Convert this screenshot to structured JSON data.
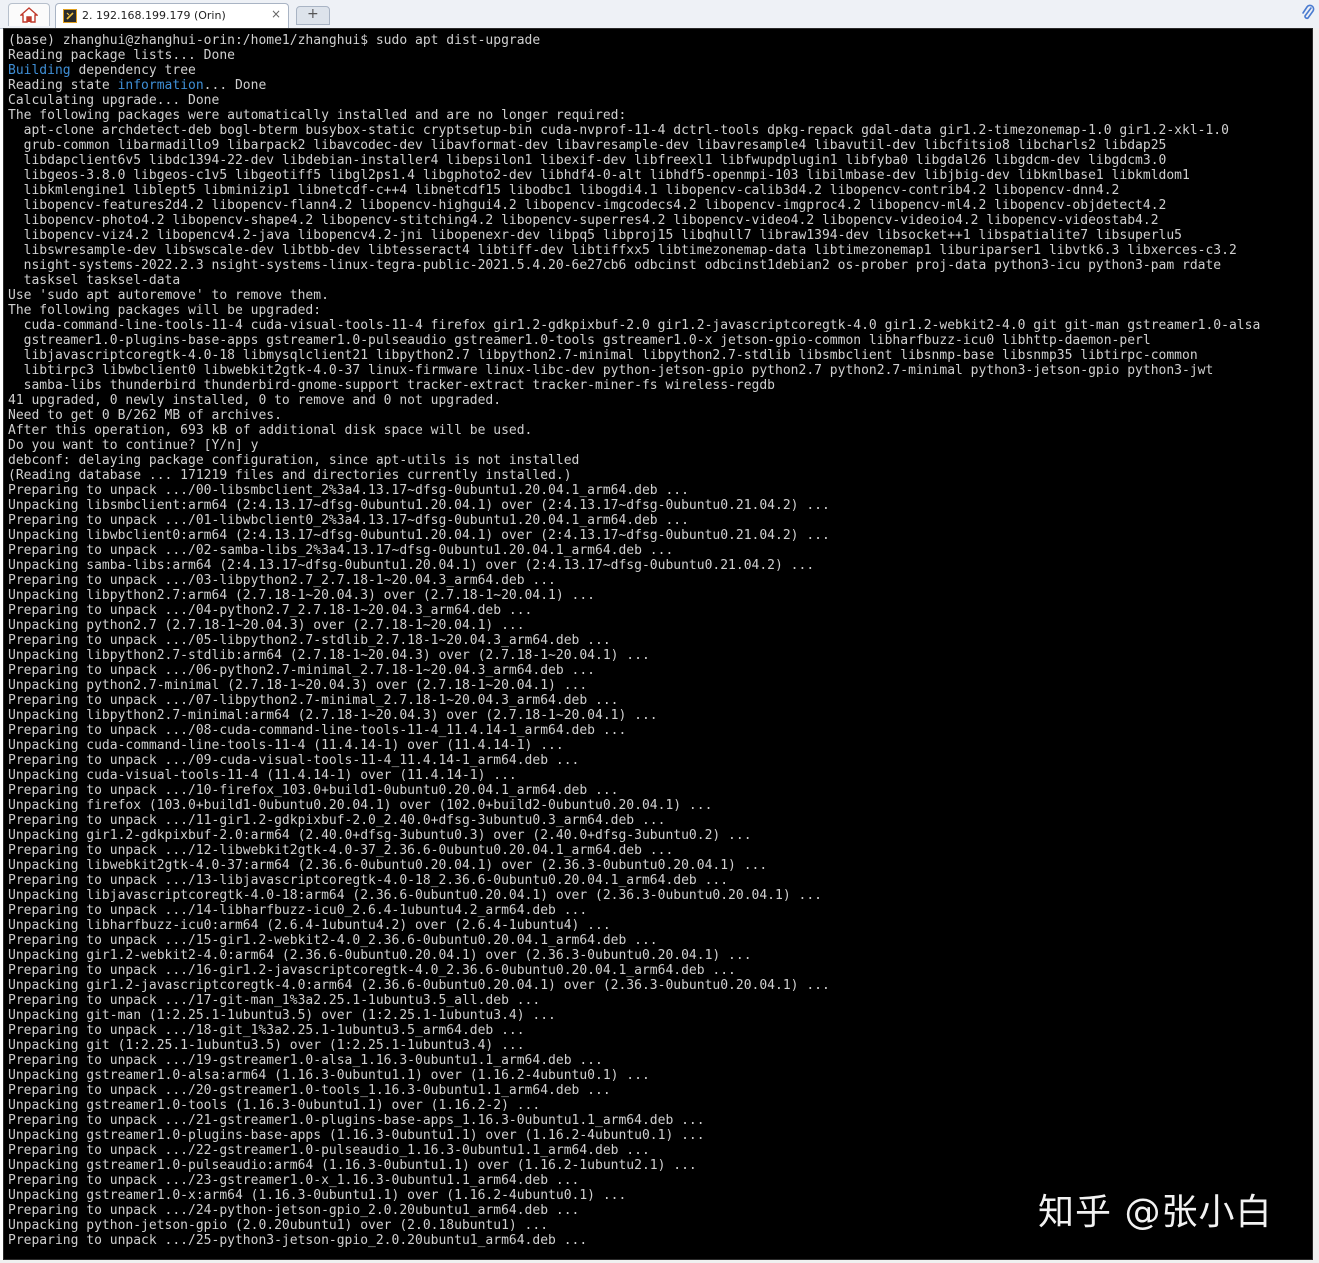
{
  "window": {
    "tab_title": "2. 192.168.199.179 (Orin)",
    "tab_close": "×",
    "newtab_symbol": "+",
    "home_icon": "home-icon",
    "paperclip_icon": "paperclip-icon"
  },
  "terminal": {
    "lines": [
      "(base) zhanghui@zhanghui-orin:/home1/zhanghui$ sudo apt dist-upgrade",
      "Reading package lists... Done",
      "Building dependency tree",
      "Reading state information... Done",
      "Calculating upgrade... Done",
      "The following packages were automatically installed and are no longer required:",
      "  apt-clone archdetect-deb bogl-bterm busybox-static cryptsetup-bin cuda-nvprof-11-4 dctrl-tools dpkg-repack gdal-data gir1.2-timezonemap-1.0 gir1.2-xkl-1.0",
      "  grub-common libarmadillo9 libarpack2 libavcodec-dev libavformat-dev libavresample-dev libavresample4 libavutil-dev libcfitsio8 libcharls2 libdap25",
      "  libdapclient6v5 libdc1394-22-dev libdebian-installer4 libepsilon1 libexif-dev libfreexl1 libfwupdplugin1 libfyba0 libgdal26 libgdcm-dev libgdcm3.0",
      "  libgeos-3.8.0 libgeos-c1v5 libgeotiff5 libgl2ps1.4 libgphoto2-dev libhdf4-0-alt libhdf5-openmpi-103 libilmbase-dev libjbig-dev libkmlbase1 libkmldom1",
      "  libkmlengine1 liblept5 libminizip1 libnetcdf-c++4 libnetcdf15 libodbc1 libogdi4.1 libopencv-calib3d4.2 libopencv-contrib4.2 libopencv-dnn4.2",
      "  libopencv-features2d4.2 libopencv-flann4.2 libopencv-highgui4.2 libopencv-imgcodecs4.2 libopencv-imgproc4.2 libopencv-ml4.2 libopencv-objdetect4.2",
      "  libopencv-photo4.2 libopencv-shape4.2 libopencv-stitching4.2 libopencv-superres4.2 libopencv-video4.2 libopencv-videoio4.2 libopencv-videostab4.2",
      "  libopencv-viz4.2 libopencv4.2-java libopencv4.2-jni libopenexr-dev libpq5 libproj15 libqhull7 libraw1394-dev libsocket++1 libspatialite7 libsuperlu5",
      "  libswresample-dev libswscale-dev libtbb-dev libtesseract4 libtiff-dev libtiffxx5 libtimezonemap-data libtimezonemap1 liburiparser1 libvtk6.3 libxerces-c3.2",
      "  nsight-systems-2022.2.3 nsight-systems-linux-tegra-public-2021.5.4.20-6e27cb6 odbcinst odbcinst1debian2 os-prober proj-data python3-icu python3-pam rdate",
      "  tasksel tasksel-data",
      "Use 'sudo apt autoremove' to remove them.",
      "The following packages will be upgraded:",
      "  cuda-command-line-tools-11-4 cuda-visual-tools-11-4 firefox gir1.2-gdkpixbuf-2.0 gir1.2-javascriptcoregtk-4.0 gir1.2-webkit2-4.0 git git-man gstreamer1.0-alsa",
      "  gstreamer1.0-plugins-base-apps gstreamer1.0-pulseaudio gstreamer1.0-tools gstreamer1.0-x jetson-gpio-common libharfbuzz-icu0 libhttp-daemon-perl",
      "  libjavascriptcoregtk-4.0-18 libmysqlclient21 libpython2.7 libpython2.7-minimal libpython2.7-stdlib libsmbclient libsnmp-base libsnmp35 libtirpc-common",
      "  libtirpc3 libwbclient0 libwebkit2gtk-4.0-37 linux-firmware linux-libc-dev python-jetson-gpio python2.7 python2.7-minimal python3-jetson-gpio python3-jwt",
      "  samba-libs thunderbird thunderbird-gnome-support tracker-extract tracker-miner-fs wireless-regdb",
      "41 upgraded, 0 newly installed, 0 to remove and 0 not upgraded.",
      "Need to get 0 B/262 MB of archives.",
      "After this operation, 693 kB of additional disk space will be used.",
      "Do you want to continue? [Y/n] y",
      "debconf: delaying package configuration, since apt-utils is not installed",
      "(Reading database ... 171219 files and directories currently installed.)",
      "Preparing to unpack .../00-libsmbclient_2%3a4.13.17~dfsg-0ubuntu1.20.04.1_arm64.deb ...",
      "Unpacking libsmbclient:arm64 (2:4.13.17~dfsg-0ubuntu1.20.04.1) over (2:4.13.17~dfsg-0ubuntu0.21.04.2) ...",
      "Preparing to unpack .../01-libwbclient0_2%3a4.13.17~dfsg-0ubuntu1.20.04.1_arm64.deb ...",
      "Unpacking libwbclient0:arm64 (2:4.13.17~dfsg-0ubuntu1.20.04.1) over (2:4.13.17~dfsg-0ubuntu0.21.04.2) ...",
      "Preparing to unpack .../02-samba-libs_2%3a4.13.17~dfsg-0ubuntu1.20.04.1_arm64.deb ...",
      "Unpacking samba-libs:arm64 (2:4.13.17~dfsg-0ubuntu1.20.04.1) over (2:4.13.17~dfsg-0ubuntu0.21.04.2) ...",
      "Preparing to unpack .../03-libpython2.7_2.7.18-1~20.04.3_arm64.deb ...",
      "Unpacking libpython2.7:arm64 (2.7.18-1~20.04.3) over (2.7.18-1~20.04.1) ...",
      "Preparing to unpack .../04-python2.7_2.7.18-1~20.04.3_arm64.deb ...",
      "Unpacking python2.7 (2.7.18-1~20.04.3) over (2.7.18-1~20.04.1) ...",
      "Preparing to unpack .../05-libpython2.7-stdlib_2.7.18-1~20.04.3_arm64.deb ...",
      "Unpacking libpython2.7-stdlib:arm64 (2.7.18-1~20.04.3) over (2.7.18-1~20.04.1) ...",
      "Preparing to unpack .../06-python2.7-minimal_2.7.18-1~20.04.3_arm64.deb ...",
      "Unpacking python2.7-minimal (2.7.18-1~20.04.3) over (2.7.18-1~20.04.1) ...",
      "Preparing to unpack .../07-libpython2.7-minimal_2.7.18-1~20.04.3_arm64.deb ...",
      "Unpacking libpython2.7-minimal:arm64 (2.7.18-1~20.04.3) over (2.7.18-1~20.04.1) ...",
      "Preparing to unpack .../08-cuda-command-line-tools-11-4_11.4.14-1_arm64.deb ...",
      "Unpacking cuda-command-line-tools-11-4 (11.4.14-1) over (11.4.14-1) ...",
      "Preparing to unpack .../09-cuda-visual-tools-11-4_11.4.14-1_arm64.deb ...",
      "Unpacking cuda-visual-tools-11-4 (11.4.14-1) over (11.4.14-1) ...",
      "Preparing to unpack .../10-firefox_103.0+build1-0ubuntu0.20.04.1_arm64.deb ...",
      "Unpacking firefox (103.0+build1-0ubuntu0.20.04.1) over (102.0+build2-0ubuntu0.20.04.1) ...",
      "Preparing to unpack .../11-gir1.2-gdkpixbuf-2.0_2.40.0+dfsg-3ubuntu0.3_arm64.deb ...",
      "Unpacking gir1.2-gdkpixbuf-2.0:arm64 (2.40.0+dfsg-3ubuntu0.3) over (2.40.0+dfsg-3ubuntu0.2) ...",
      "Preparing to unpack .../12-libwebkit2gtk-4.0-37_2.36.6-0ubuntu0.20.04.1_arm64.deb ...",
      "Unpacking libwebkit2gtk-4.0-37:arm64 (2.36.6-0ubuntu0.20.04.1) over (2.36.3-0ubuntu0.20.04.1) ...",
      "Preparing to unpack .../13-libjavascriptcoregtk-4.0-18_2.36.6-0ubuntu0.20.04.1_arm64.deb ...",
      "Unpacking libjavascriptcoregtk-4.0-18:arm64 (2.36.6-0ubuntu0.20.04.1) over (2.36.3-0ubuntu0.20.04.1) ...",
      "Preparing to unpack .../14-libharfbuzz-icu0_2.6.4-1ubuntu4.2_arm64.deb ...",
      "Unpacking libharfbuzz-icu0:arm64 (2.6.4-1ubuntu4.2) over (2.6.4-1ubuntu4) ...",
      "Preparing to unpack .../15-gir1.2-webkit2-4.0_2.36.6-0ubuntu0.20.04.1_arm64.deb ...",
      "Unpacking gir1.2-webkit2-4.0:arm64 (2.36.6-0ubuntu0.20.04.1) over (2.36.3-0ubuntu0.20.04.1) ...",
      "Preparing to unpack .../16-gir1.2-javascriptcoregtk-4.0_2.36.6-0ubuntu0.20.04.1_arm64.deb ...",
      "Unpacking gir1.2-javascriptcoregtk-4.0:arm64 (2.36.6-0ubuntu0.20.04.1) over (2.36.3-0ubuntu0.20.04.1) ...",
      "Preparing to unpack .../17-git-man_1%3a2.25.1-1ubuntu3.5_all.deb ...",
      "Unpacking git-man (1:2.25.1-1ubuntu3.5) over (1:2.25.1-1ubuntu3.4) ...",
      "Preparing to unpack .../18-git_1%3a2.25.1-1ubuntu3.5_arm64.deb ...",
      "Unpacking git (1:2.25.1-1ubuntu3.5) over (1:2.25.1-1ubuntu3.4) ...",
      "Preparing to unpack .../19-gstreamer1.0-alsa_1.16.3-0ubuntu1.1_arm64.deb ...",
      "Unpacking gstreamer1.0-alsa:arm64 (1.16.3-0ubuntu1.1) over (1.16.2-4ubuntu0.1) ...",
      "Preparing to unpack .../20-gstreamer1.0-tools_1.16.3-0ubuntu1.1_arm64.deb ...",
      "Unpacking gstreamer1.0-tools (1.16.3-0ubuntu1.1) over (1.16.2-2) ...",
      "Preparing to unpack .../21-gstreamer1.0-plugins-base-apps_1.16.3-0ubuntu1.1_arm64.deb ...",
      "Unpacking gstreamer1.0-plugins-base-apps (1.16.3-0ubuntu1.1) over (1.16.2-4ubuntu0.1) ...",
      "Preparing to unpack .../22-gstreamer1.0-pulseaudio_1.16.3-0ubuntu1.1_arm64.deb ...",
      "Unpacking gstreamer1.0-pulseaudio:arm64 (1.16.3-0ubuntu1.1) over (1.16.2-1ubuntu2.1) ...",
      "Preparing to unpack .../23-gstreamer1.0-x_1.16.3-0ubuntu1.1_arm64.deb ...",
      "Unpacking gstreamer1.0-x:arm64 (1.16.3-0ubuntu1.1) over (1.16.2-4ubuntu0.1) ...",
      "Preparing to unpack .../24-python-jetson-gpio_2.0.20ubuntu1_arm64.deb ...",
      "Unpacking python-jetson-gpio (2.0.20ubuntu1) over (2.0.18ubuntu1) ...",
      "Preparing to unpack .../25-python3-jetson-gpio_2.0.20ubuntu1_arm64.deb ..."
    ],
    "highlight_color": "#3f8fd6",
    "text_color": "#d0d0d0",
    "background_color": "#000000"
  },
  "watermark": {
    "text": "知乎 @张小白"
  }
}
